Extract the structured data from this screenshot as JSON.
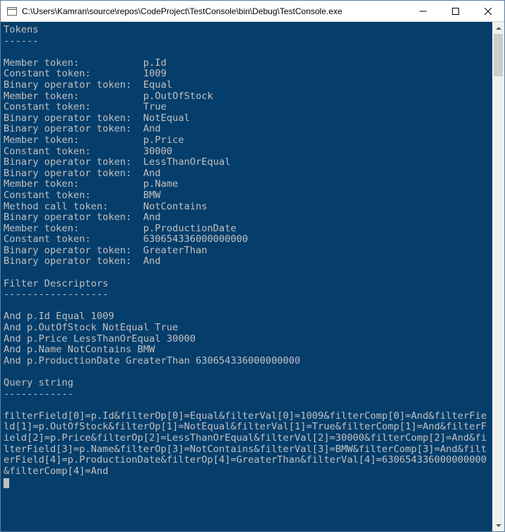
{
  "window": {
    "title": "C:\\Users\\Kamran\\source\\repos\\CodeProject\\TestConsole\\bin\\Debug\\TestConsole.exe"
  },
  "console": {
    "tokens_header": "Tokens",
    "tokens_rule": "------",
    "rows": [
      {
        "label": "Member token:",
        "value": "p.Id"
      },
      {
        "label": "Constant token:",
        "value": "1009"
      },
      {
        "label": "Binary operator token:",
        "value": "Equal"
      },
      {
        "label": "Member token:",
        "value": "p.OutOfStock"
      },
      {
        "label": "Constant token:",
        "value": "True"
      },
      {
        "label": "Binary operator token:",
        "value": "NotEqual"
      },
      {
        "label": "Binary operator token:",
        "value": "And"
      },
      {
        "label": "Member token:",
        "value": "p.Price"
      },
      {
        "label": "Constant token:",
        "value": "30000"
      },
      {
        "label": "Binary operator token:",
        "value": "LessThanOrEqual"
      },
      {
        "label": "Binary operator token:",
        "value": "And"
      },
      {
        "label": "Member token:",
        "value": "p.Name"
      },
      {
        "label": "Constant token:",
        "value": "BMW"
      },
      {
        "label": "Method call token:",
        "value": "NotContains"
      },
      {
        "label": "Binary operator token:",
        "value": "And"
      },
      {
        "label": "Member token:",
        "value": "p.ProductionDate"
      },
      {
        "label": "Constant token:",
        "value": "630654336000000000"
      },
      {
        "label": "Binary operator token:",
        "value": "GreaterThan"
      },
      {
        "label": "Binary operator token:",
        "value": "And"
      }
    ],
    "label_col_width": 24,
    "filters_header": "Filter Descriptors",
    "filters_rule": "------------------",
    "filters": [
      "And p.Id Equal 1009",
      "And p.OutOfStock NotEqual True",
      "And p.Price LessThanOrEqual 30000",
      "And p.Name NotContains BMW",
      "And p.ProductionDate GreaterThan 630654336000000000"
    ],
    "query_header": "Query string",
    "query_rule": "------------",
    "query": "filterField[0]=p.Id&filterOp[0]=Equal&filterVal[0]=1009&filterComp[0]=And&filterField[1]=p.OutOfStock&filterOp[1]=NotEqual&filterVal[1]=True&filterComp[1]=And&filterField[2]=p.Price&filterOp[2]=LessThanOrEqual&filterVal[2]=30000&filterComp[2]=And&filterField[3]=p.Name&filterOp[3]=NotContains&filterVal[3]=BMW&filterComp[3]=And&filterField[4]=p.ProductionDate&filterOp[4]=GreaterThan&filterVal[4]=630654336000000000&filterComp[4]=And"
  }
}
